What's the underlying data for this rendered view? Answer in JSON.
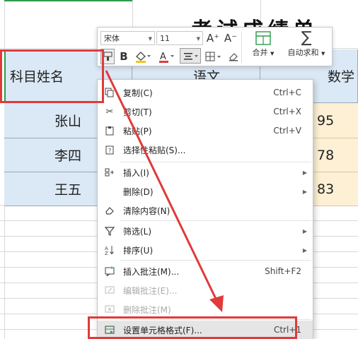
{
  "sheet": {
    "title": "考试成绩单",
    "header": {
      "subject_name": "科目姓名",
      "chinese": "语文",
      "math": "数学"
    },
    "rows": [
      {
        "name": "张山",
        "math": "95"
      },
      {
        "name": "李四",
        "math": "78"
      },
      {
        "name": "王五",
        "math": "83"
      }
    ]
  },
  "toolbar": {
    "font_name": "宋体",
    "font_size": "11",
    "increase_font": "A⁺",
    "decrease_font": "A⁻",
    "bold": "B",
    "merge_label": "合并",
    "autosum_label": "自动求和",
    "colors": {
      "font_color": "#e03a3a",
      "fill_color": "#f5c518",
      "sheet_border_green": "#2e9b4a"
    }
  },
  "menu": {
    "items": [
      {
        "label": "复制(C)",
        "shortcut": "Ctrl+C",
        "icon": "copy-icon"
      },
      {
        "label": "剪切(T)",
        "shortcut": "Ctrl+X",
        "icon": "scissors-icon"
      },
      {
        "label": "粘贴(P)",
        "shortcut": "Ctrl+V",
        "icon": "paste-icon"
      },
      {
        "label": "选择性粘贴(S)...",
        "icon": "paste-special-icon"
      },
      {
        "label": "插入(I)",
        "icon": "insert-icon",
        "submenu": true
      },
      {
        "label": "删除(D)",
        "submenu": true
      },
      {
        "label": "清除内容(N)",
        "icon": "eraser-icon"
      },
      {
        "label": "筛选(L)",
        "icon": "filter-icon",
        "submenu": true
      },
      {
        "label": "排序(U)",
        "icon": "sort-icon",
        "submenu": true
      },
      {
        "label": "插入批注(M)...",
        "shortcut": "Shift+F2",
        "icon": "insert-comment-icon"
      },
      {
        "label": "编辑批注(E)...",
        "icon": "edit-comment-icon",
        "disabled": true
      },
      {
        "label": "删除批注(M)",
        "icon": "delete-comment-icon",
        "disabled": true
      },
      {
        "label": "设置单元格格式(F)...",
        "shortcut": "Ctrl+1",
        "icon": "format-cells-icon"
      }
    ]
  },
  "annotation_color": "#e03a3a"
}
